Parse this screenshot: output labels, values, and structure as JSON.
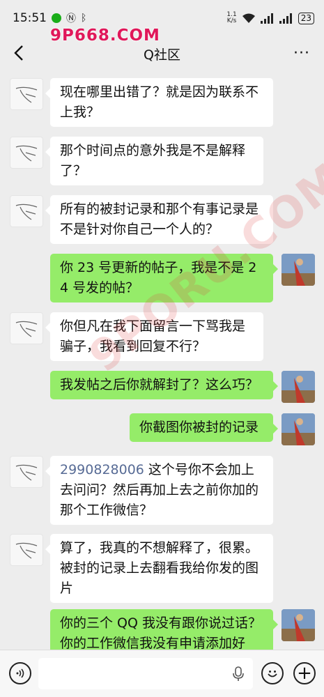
{
  "status_bar": {
    "time": "15:51",
    "net_speed_value": "1.1",
    "net_speed_unit": "K/s",
    "battery": "23"
  },
  "watermark_top": "9P668.COM",
  "watermark_diagonal": "9PORU.COM",
  "header": {
    "title": "Q社区"
  },
  "messages": [
    {
      "side": "left",
      "text": "现在哪里出错了？就是因为联系不上我？"
    },
    {
      "side": "left",
      "text": "那个时间点的意外我是不是解释了？"
    },
    {
      "side": "left",
      "text": "所有的被封记录和那个有事记录是不是针对你自己一个人的？"
    },
    {
      "side": "right",
      "text": "你 23 号更新的帖子，我是不是 24 号发的帖？"
    },
    {
      "side": "left",
      "text": "你但凡在我下面留言一下骂我是骗子，我看到回复不行？"
    },
    {
      "side": "right",
      "text": "我发帖之后你就解封了？这么巧？"
    },
    {
      "side": "right",
      "text": "你截图你被封的记录"
    },
    {
      "side": "left",
      "number": "2990828006",
      "text": " 这个号你不会加上去问问？然后再加上去之前你加的那个工作微信？"
    },
    {
      "side": "left",
      "text": "算了，我真的不想解释了，很累。被封的记录上去翻看我给你发的图片"
    },
    {
      "side": "right",
      "text": "你的三个 QQ 我没有跟你说过话？你的工作微信我没有申请添加好"
    }
  ],
  "colors": {
    "background": "#ededed",
    "bubble_self": "#95ec69",
    "bubble_other": "#ffffff",
    "link": "#576b95",
    "watermark": "#e0185a"
  },
  "icons": [
    "back-arrow-icon",
    "more-icon",
    "voice-icon",
    "mic-icon",
    "emoji-icon",
    "plus-icon"
  ]
}
